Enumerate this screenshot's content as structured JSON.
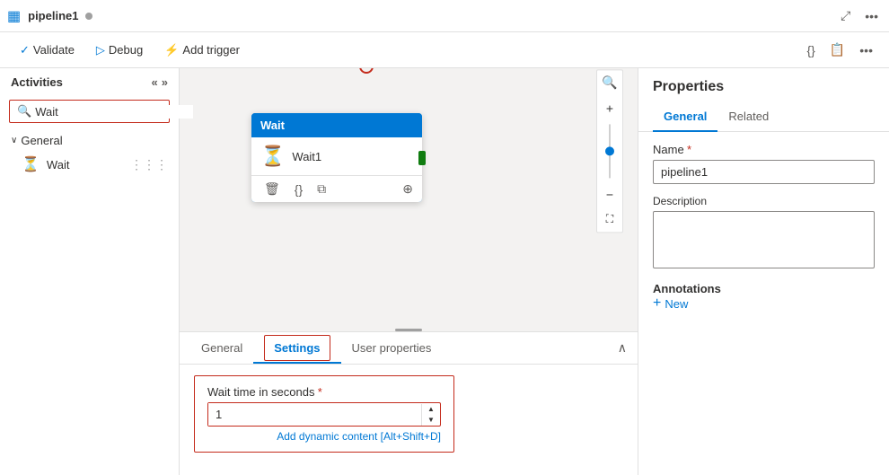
{
  "titlebar": {
    "logo": "▦",
    "name": "pipeline1",
    "dot_visible": true,
    "icons": [
      "⤢",
      "•••"
    ]
  },
  "toolbar": {
    "validate_label": "Validate",
    "debug_label": "Debug",
    "add_trigger_label": "Add trigger",
    "right_icons": [
      "{}",
      "📋",
      "•••"
    ]
  },
  "sidebar": {
    "title": "Activities",
    "collapse_icons": [
      "«",
      "»"
    ],
    "search_placeholder": "Wait",
    "search_value": "Wait",
    "sections": [
      {
        "label": "General",
        "items": [
          {
            "name": "Wait",
            "icon": "⏳"
          }
        ]
      }
    ]
  },
  "canvas": {
    "wait_node": {
      "title": "Wait",
      "activity_name": "Wait1",
      "icon": "⏳"
    },
    "zoom_controls": {
      "search_icon": "🔍",
      "plus_icon": "+",
      "minus_icon": "−",
      "fit_icon": "⛶"
    }
  },
  "bottom_panel": {
    "tabs": [
      {
        "label": "General",
        "active": false
      },
      {
        "label": "Settings",
        "active": true
      },
      {
        "label": "User properties",
        "active": false
      }
    ],
    "settings": {
      "wait_time_label": "Wait time in seconds",
      "wait_time_required": "*",
      "wait_time_value": "1",
      "dynamic_content_link": "Add dynamic content [Alt+Shift+D]"
    }
  },
  "properties": {
    "title": "Properties",
    "tabs": [
      {
        "label": "General",
        "active": true
      },
      {
        "label": "Related",
        "active": false
      }
    ],
    "name_label": "Name",
    "name_required": "*",
    "name_value": "pipeline1",
    "description_label": "Description",
    "description_value": "",
    "annotations_label": "Annotations",
    "new_button_label": "New"
  }
}
